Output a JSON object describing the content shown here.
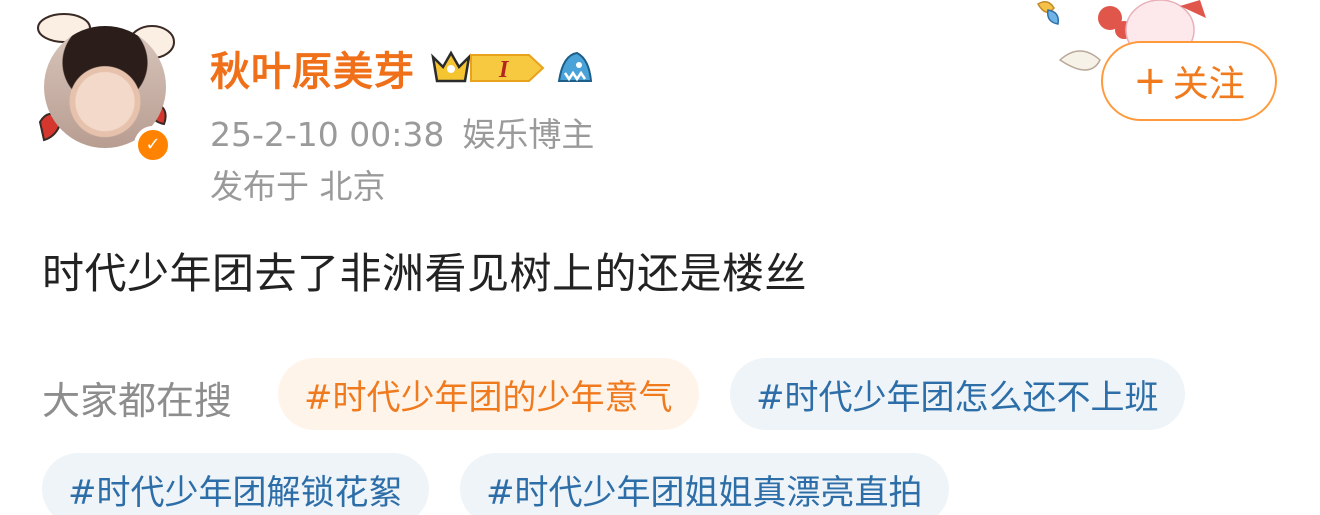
{
  "user": {
    "name": "秋叶原美芽",
    "level_badge_text": "I",
    "timestamp": "25-2-10 00:38",
    "role": "娱乐博主",
    "location": "发布于 北京"
  },
  "follow_button": {
    "plus": "+",
    "label": "关注"
  },
  "post": {
    "text": "时代少年团去了非洲看见树上的还是楼丝"
  },
  "trending": {
    "label": "大家都在搜",
    "tags": [
      "#时代少年团的少年意气",
      "#时代少年团怎么还不上班",
      "#时代少年团解锁花絮",
      "#时代少年团姐姐真漂亮直拍"
    ]
  },
  "colors": {
    "accent": "#f07a1e",
    "tag_blue_text": "#2d6ea8",
    "tag_blue_bg": "#eef4f8",
    "tag_orange_bg": "#fff4ea",
    "muted_text": "#9a9a9a"
  }
}
